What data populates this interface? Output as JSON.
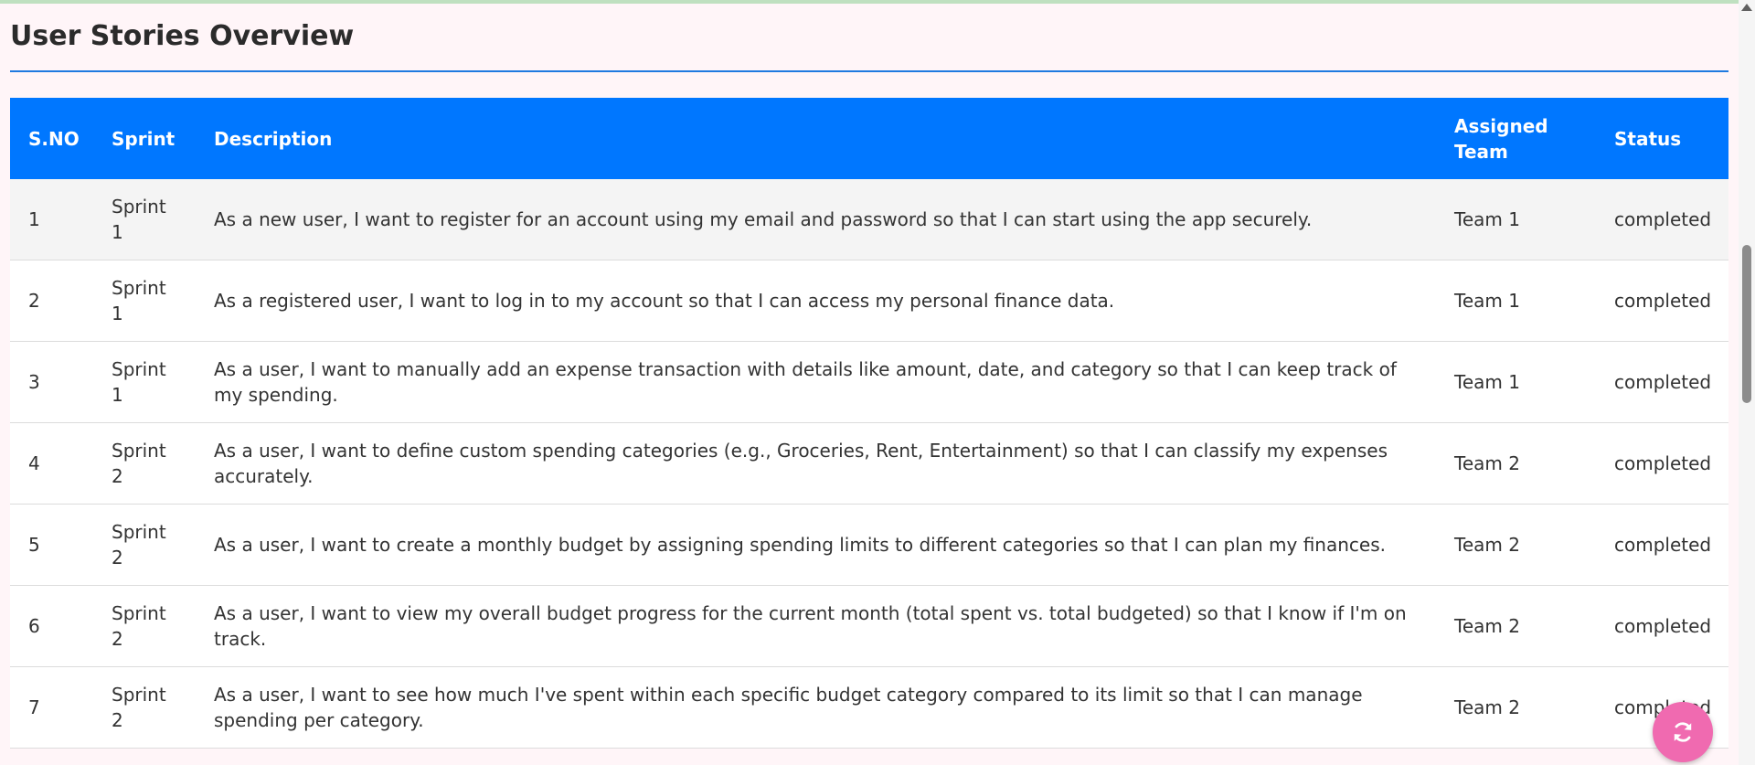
{
  "page": {
    "title": "User Stories Overview"
  },
  "table": {
    "headers": {
      "sno": "S.NO",
      "sprint": "Sprint",
      "description": "Description",
      "team": "Assigned Team",
      "status": "Status"
    },
    "rows": [
      {
        "sno": "1",
        "sprint": "Sprint 1",
        "description": "As a new user, I want to register for an account using my email and password so that I can start using the app securely.",
        "team": "Team 1",
        "status": "completed"
      },
      {
        "sno": "2",
        "sprint": "Sprint 1",
        "description": "As a registered user, I want to log in to my account so that I can access my personal finance data.",
        "team": "Team 1",
        "status": "completed"
      },
      {
        "sno": "3",
        "sprint": "Sprint 1",
        "description": "As a user, I want to manually add an expense transaction with details like amount, date, and category so that I can keep track of my spending.",
        "team": "Team 1",
        "status": "completed"
      },
      {
        "sno": "4",
        "sprint": "Sprint 2",
        "description": "As a user, I want to define custom spending categories (e.g., Groceries, Rent, Entertainment) so that I can classify my expenses accurately.",
        "team": "Team 2",
        "status": "completed"
      },
      {
        "sno": "5",
        "sprint": "Sprint 2",
        "description": "As a user, I want to create a monthly budget by assigning spending limits to different categories so that I can plan my finances.",
        "team": "Team 2",
        "status": "completed"
      },
      {
        "sno": "6",
        "sprint": "Sprint 2",
        "description": "As a user, I want to view my overall budget progress for the current month (total spent vs. total budgeted) so that I know if I'm on track.",
        "team": "Team 2",
        "status": "completed"
      },
      {
        "sno": "7",
        "sprint": "Sprint 2",
        "description": "As a user, I want to see how much I've spent within each specific budget category compared to its limit so that I can manage spending per category.",
        "team": "Team 2",
        "status": "completed"
      }
    ]
  },
  "fab": {
    "icon": "refresh-icon"
  },
  "colors": {
    "header_bg": "#0077ff",
    "title_rule": "#1f7ae0",
    "page_bg": "#fff5f8",
    "fab_bg": "#f06ab0"
  }
}
